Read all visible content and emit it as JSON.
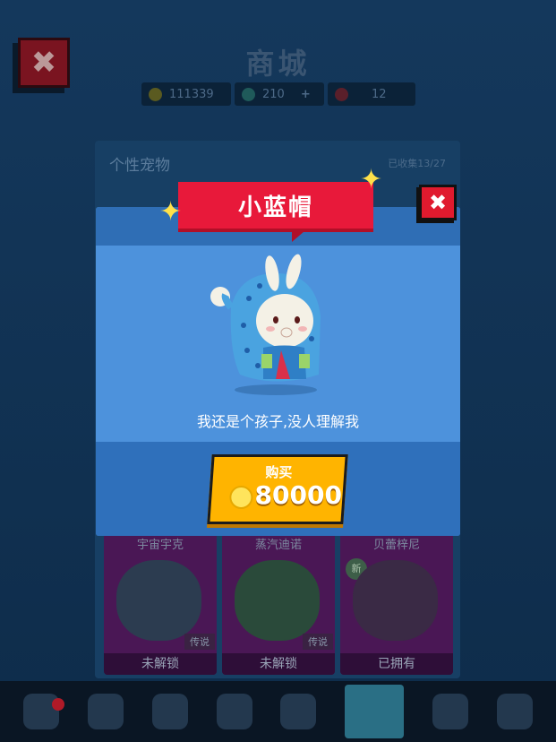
{
  "shop": {
    "title": "商城",
    "close_icon": "close-icon",
    "resources": {
      "coins": "111339",
      "gems": "210",
      "plus": "+",
      "tickets": "12"
    }
  },
  "panel": {
    "title": "个性宠物",
    "collected": "已收集13/27"
  },
  "cards": [
    {
      "name": "宇宙宇克",
      "tag": "传说",
      "status": "未解锁"
    },
    {
      "name": "蒸汽迪诺",
      "tag": "传说",
      "status": "未解锁"
    },
    {
      "name": "贝蕾梓尼",
      "new": "新",
      "status": "已拥有"
    }
  ],
  "modal": {
    "pet_name": "小蓝帽",
    "description": "我还是个孩子,没人理解我",
    "buy_label": "购买",
    "price": "80000",
    "colors": {
      "ribbon": "#e8193a",
      "button": "#ffb400",
      "body": "#4d92dc"
    }
  },
  "bottom_tabs": [
    "robot-icon",
    "chest-icon",
    "chat-icon",
    "creature-icon",
    "face-icon",
    "pet-icon",
    "stamp-icon",
    "lotus-icon"
  ]
}
